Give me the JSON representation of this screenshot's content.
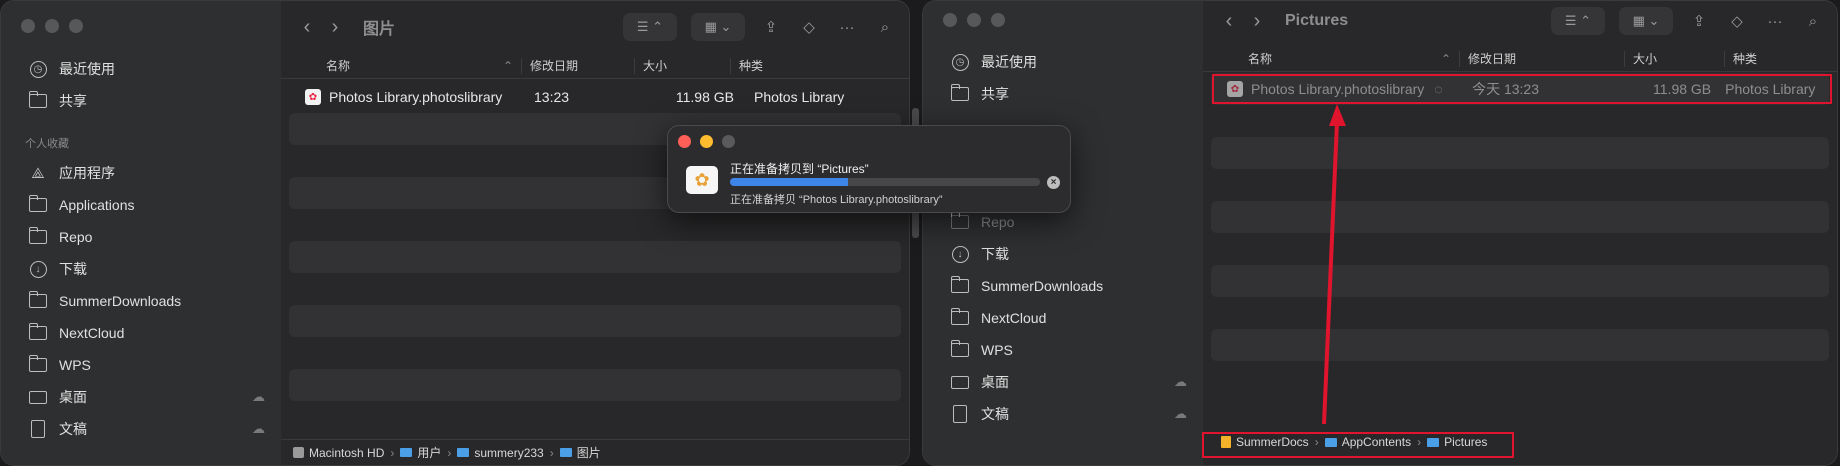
{
  "left_window": {
    "title": "图片",
    "sidebar": {
      "items_top": [
        {
          "label": "最近使用",
          "icon": "clock-icon"
        },
        {
          "label": "共享",
          "icon": "shared-folder-icon"
        }
      ],
      "section": "个人收藏",
      "items": [
        {
          "label": "应用程序",
          "icon": "apps-icon"
        },
        {
          "label": "Applications",
          "icon": "folder-icon"
        },
        {
          "label": "Repo",
          "icon": "folder-icon"
        },
        {
          "label": "下载",
          "icon": "download-icon"
        },
        {
          "label": "SummerDownloads",
          "icon": "folder-icon"
        },
        {
          "label": "NextCloud",
          "icon": "folder-icon"
        },
        {
          "label": "WPS",
          "icon": "folder-icon"
        },
        {
          "label": "桌面",
          "icon": "desktop-icon"
        },
        {
          "label": "文稿",
          "icon": "document-icon"
        }
      ]
    },
    "columns": {
      "name": "名称",
      "date": "修改日期",
      "size": "大小",
      "kind": "种类"
    },
    "file": {
      "name": "Photos Library.photoslibrary",
      "date": "13:23",
      "size": "11.98 GB",
      "kind": "Photos Library"
    },
    "path": [
      "Macintosh HD",
      "用户",
      "summery233",
      "图片"
    ]
  },
  "dialog": {
    "title": "正在准备拷贝到 “Pictures”",
    "subtitle": "正在准备拷贝 “Photos Library.photoslibrary”",
    "progress": 0.38,
    "colors": {
      "close": "#ff5f57",
      "minimize": "#febc2e",
      "zoom": "#5a5a5c"
    }
  },
  "right_window": {
    "title": "Pictures",
    "sidebar": {
      "items_top": [
        {
          "label": "最近使用",
          "icon": "clock-icon"
        },
        {
          "label": "共享",
          "icon": "shared-folder-icon"
        }
      ],
      "items": [
        {
          "label": "Repo",
          "icon": "folder-icon"
        },
        {
          "label": "下载",
          "icon": "download-icon"
        },
        {
          "label": "SummerDownloads",
          "icon": "folder-icon"
        },
        {
          "label": "NextCloud",
          "icon": "folder-icon"
        },
        {
          "label": "WPS",
          "icon": "folder-icon"
        },
        {
          "label": "桌面",
          "icon": "desktop-icon"
        },
        {
          "label": "文稿",
          "icon": "document-icon"
        }
      ]
    },
    "columns": {
      "name": "名称",
      "date": "修改日期",
      "size": "大小",
      "kind": "种类"
    },
    "file": {
      "name": "Photos Library.photoslibrary",
      "date": "今天 13:23",
      "size": "11.98 GB",
      "kind": "Photos Library"
    },
    "path": [
      "SummerDocs",
      "AppContents",
      "Pictures"
    ]
  },
  "annotation_color": "#e0142c"
}
